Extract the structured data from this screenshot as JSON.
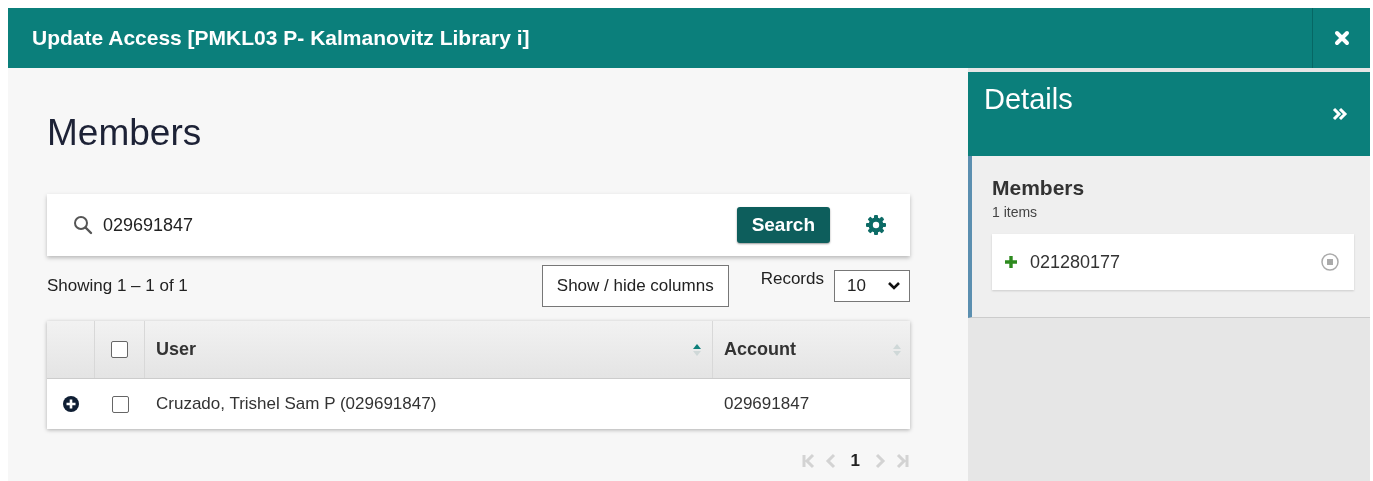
{
  "window": {
    "title": "Update Access [PMKL03 P- Kalmanovitz Library i]"
  },
  "main": {
    "title": "Members",
    "search": {
      "value": "029691847",
      "button": "Search"
    },
    "showing": "Showing 1 – 1 of 1",
    "show_hide_button": "Show / hide columns",
    "records": {
      "label": "Records",
      "value": "10"
    },
    "table": {
      "header_checked": false,
      "columns": [
        {
          "label": "User",
          "sorted_ascending": true
        },
        {
          "label": "Account",
          "sorted_ascending": false
        }
      ],
      "rows": [
        {
          "checked": false,
          "cells": [
            "Cruzado, Trishel Sam P (029691847)",
            "029691847"
          ]
        }
      ]
    },
    "pagination": {
      "nav": [
        {
          "kind": "first",
          "disabled": true
        },
        {
          "kind": "prev",
          "disabled": true
        },
        {
          "kind": "next",
          "disabled": true
        },
        {
          "kind": "last",
          "disabled": true
        }
      ],
      "pages": [
        {
          "label": "1",
          "selected": true
        }
      ]
    }
  },
  "details": {
    "title": "Details",
    "section": {
      "title": "Members",
      "count": "1 items",
      "items": [
        {
          "value": "021280177"
        }
      ]
    }
  }
}
